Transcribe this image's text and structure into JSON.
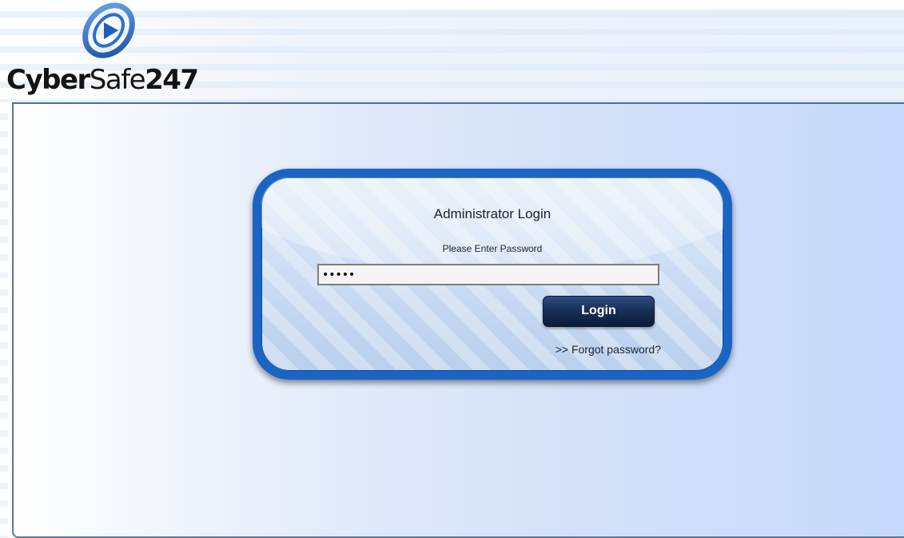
{
  "header": {
    "logo": {
      "name_bold": "Cyber",
      "name_regular": "Safe",
      "name_number": "247",
      "icon": "cybersafe-logo-icon"
    }
  },
  "login": {
    "title": "Administrator Login",
    "prompt": "Please Enter Password",
    "password_value": "•••••",
    "login_label": "Login",
    "forgot_label": ">> Forgot password?"
  },
  "colors": {
    "card_border": "#1a64c4",
    "button": "#18305a",
    "logo_blue": "#1f5fb8"
  }
}
